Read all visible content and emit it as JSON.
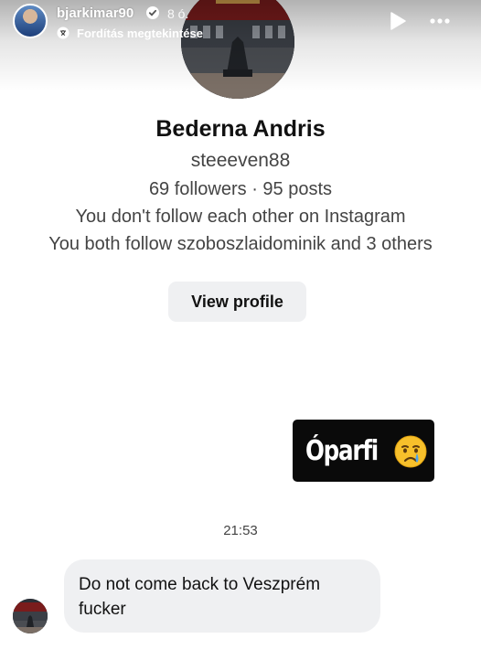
{
  "story": {
    "username": "bjarkimar90",
    "time": "8 ó.",
    "translate_label": "Fordítás megtekintése",
    "icons": [
      "verified-icon",
      "translate-icon",
      "play-icon",
      "more-icon"
    ]
  },
  "profile": {
    "name": "Bederna Andris",
    "handle": "steeeven88",
    "stats": "69 followers · 95 posts",
    "follow_status": "You don't follow each other on Instagram",
    "mutual": "You both follow szoboszlaidominik and 3 others",
    "view_profile_label": "View profile"
  },
  "messages": {
    "sent_text": "Óparfi",
    "sent_emoji": "crying-face-emoji",
    "timestamp": "21:53",
    "received_text": "Do not come back to Veszprém fucker"
  },
  "colors": {
    "bubble_bg": "#eff0f2",
    "button_bg": "#eff0f2",
    "sticker_bg": "#0a0a0a",
    "text_secondary": "#444444"
  }
}
